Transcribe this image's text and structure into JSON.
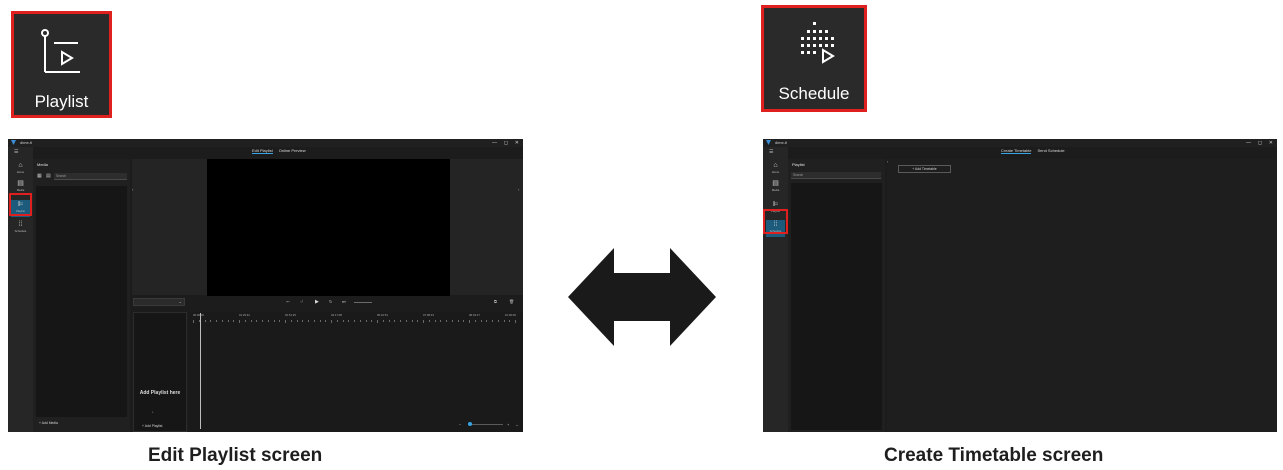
{
  "playlist_zoom": {
    "label": "Playlist",
    "icon": "playlist-icon"
  },
  "schedule_zoom": {
    "label": "Schedule",
    "icon": "schedule-icon"
  },
  "left_window": {
    "app_name": "dime-tl",
    "window_controls": {
      "minimize": "—",
      "maximize": "◻",
      "close": "✕"
    },
    "tabs": [
      "Edit Playlist",
      "Online Preview"
    ],
    "active_tab": "Edit Playlist",
    "rail": [
      {
        "label": "Home",
        "icon": "home-icon"
      },
      {
        "label": "Media",
        "icon": "media-icon"
      },
      {
        "label": "Playlist",
        "icon": "playlist-icon"
      },
      {
        "label": "Schedule",
        "icon": "schedule-icon"
      }
    ],
    "media_panel": {
      "title": "Media",
      "search_placeholder": "Search",
      "add_button": "+ Add Media"
    },
    "playlist_dropzone": {
      "text": "Add Playlist here",
      "add_button": "+ Add Playlist"
    },
    "timeline_ticks": [
      "00:00:00",
      "01:25:42",
      "02:51:25",
      "04:17:08",
      "05:42:51",
      "07:08:34",
      "08:34:17",
      "10:00:00"
    ]
  },
  "right_window": {
    "app_name": "dime-tl",
    "window_controls": {
      "minimize": "—",
      "maximize": "◻",
      "close": "✕"
    },
    "tabs": [
      "Create Timetable",
      "Send Schedule"
    ],
    "active_tab": "Create Timetable",
    "rail": [
      {
        "label": "Home",
        "icon": "home-icon"
      },
      {
        "label": "Media",
        "icon": "media-icon"
      },
      {
        "label": "Playlist",
        "icon": "playlist-icon"
      },
      {
        "label": "Schedule",
        "icon": "schedule-icon"
      }
    ],
    "playlist_panel": {
      "title": "Playlist",
      "search_placeholder": "Search"
    },
    "add_timetable_button": "+ Add Timetable"
  },
  "captions": {
    "left": "Edit Playlist screen",
    "right": "Create Timetable screen"
  },
  "colors": {
    "highlight": "#e0201f",
    "active_rail": "#1d5b7d",
    "accent": "#35a5e5",
    "arrow": "#1a1a1a"
  }
}
